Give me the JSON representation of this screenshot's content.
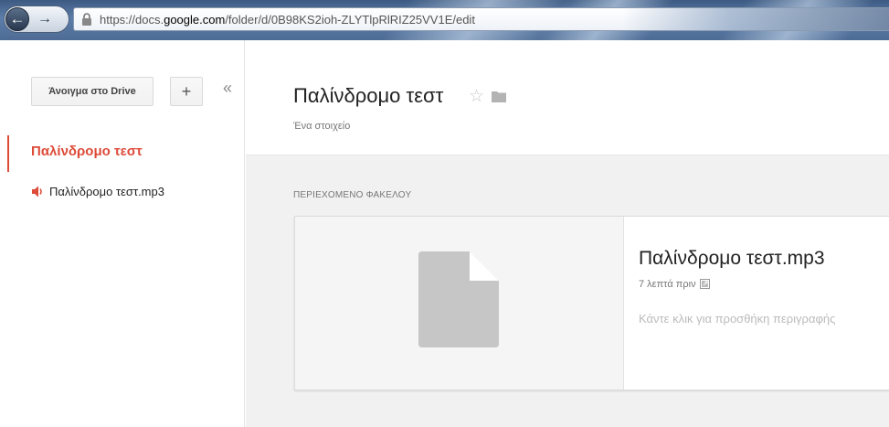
{
  "browser": {
    "url_prefix": "https://docs.",
    "url_host": "google.com",
    "url_path": "/folder/d/0B98KS2ioh-ZLYTlpRlRIZ25VV1E/edit"
  },
  "sidebar": {
    "open_button": "Άνοιγμα στο Drive",
    "add_button": "+",
    "collapse_glyph": "«",
    "folder_title": "Παλίνδρομο τεστ",
    "items": [
      {
        "label": "Παλίνδρομο τεστ.mp3",
        "icon": "speaker-icon"
      }
    ]
  },
  "header": {
    "title": "Παλίνδρομο τεστ",
    "subtitle": "Ένα στοιχείο",
    "icons": [
      "star-icon",
      "folder-icon"
    ]
  },
  "content": {
    "section_label": "ΠΕΡΙΕΧΟΜΕΝΟ ΦΑΚΕΛΟΥ",
    "file": {
      "name": "Παλίνδρομο τεστ.mp3",
      "time": "7 λεπτά πριν",
      "description_placeholder": "Κάντε κλικ για προσθήκη περιγραφής"
    }
  },
  "colors": {
    "accent": "#dd4b39",
    "content_bg": "#f1f1f1",
    "doc_icon": "#c6c6c6"
  }
}
